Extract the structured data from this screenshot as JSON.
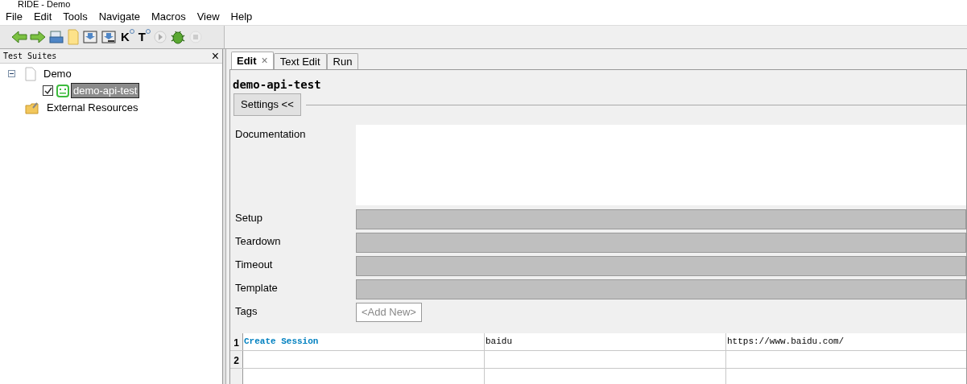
{
  "window": {
    "title": "RIDE - Demo"
  },
  "menu": [
    "File",
    "Edit",
    "Tools",
    "Navigate",
    "Macros",
    "View",
    "Help"
  ],
  "toolbar_letters": [
    "K",
    "T"
  ],
  "tree_panel": {
    "title": "Test Suites",
    "close": "×"
  },
  "tree": [
    {
      "label": "Demo",
      "expanded": true,
      "children": [
        {
          "label": "demo-api-test",
          "checked": true,
          "selected": true
        }
      ]
    },
    {
      "label": "External Resources"
    }
  ],
  "tabs": [
    {
      "label": "Edit",
      "selected": true,
      "close": "×"
    },
    {
      "label": "Text Edit",
      "selected": false
    },
    {
      "label": "Run",
      "selected": false
    }
  ],
  "editor": {
    "title": "demo-api-test",
    "settings_button": "Settings <<",
    "settings": [
      {
        "kind": "text",
        "label": "Documentation"
      },
      {
        "kind": "field",
        "label": "Setup"
      },
      {
        "kind": "field",
        "label": "Teardown"
      },
      {
        "kind": "field",
        "label": "Timeout"
      },
      {
        "kind": "field",
        "label": "Template"
      },
      {
        "kind": "tags",
        "label": "Tags",
        "button": "<Add New>"
      }
    ]
  },
  "grid": {
    "rows": [
      {
        "number": "1",
        "cells": [
          "Create Session",
          "baidu",
          "https://www.baidu.com/"
        ]
      },
      {
        "number": "2",
        "cells": []
      }
    ]
  }
}
